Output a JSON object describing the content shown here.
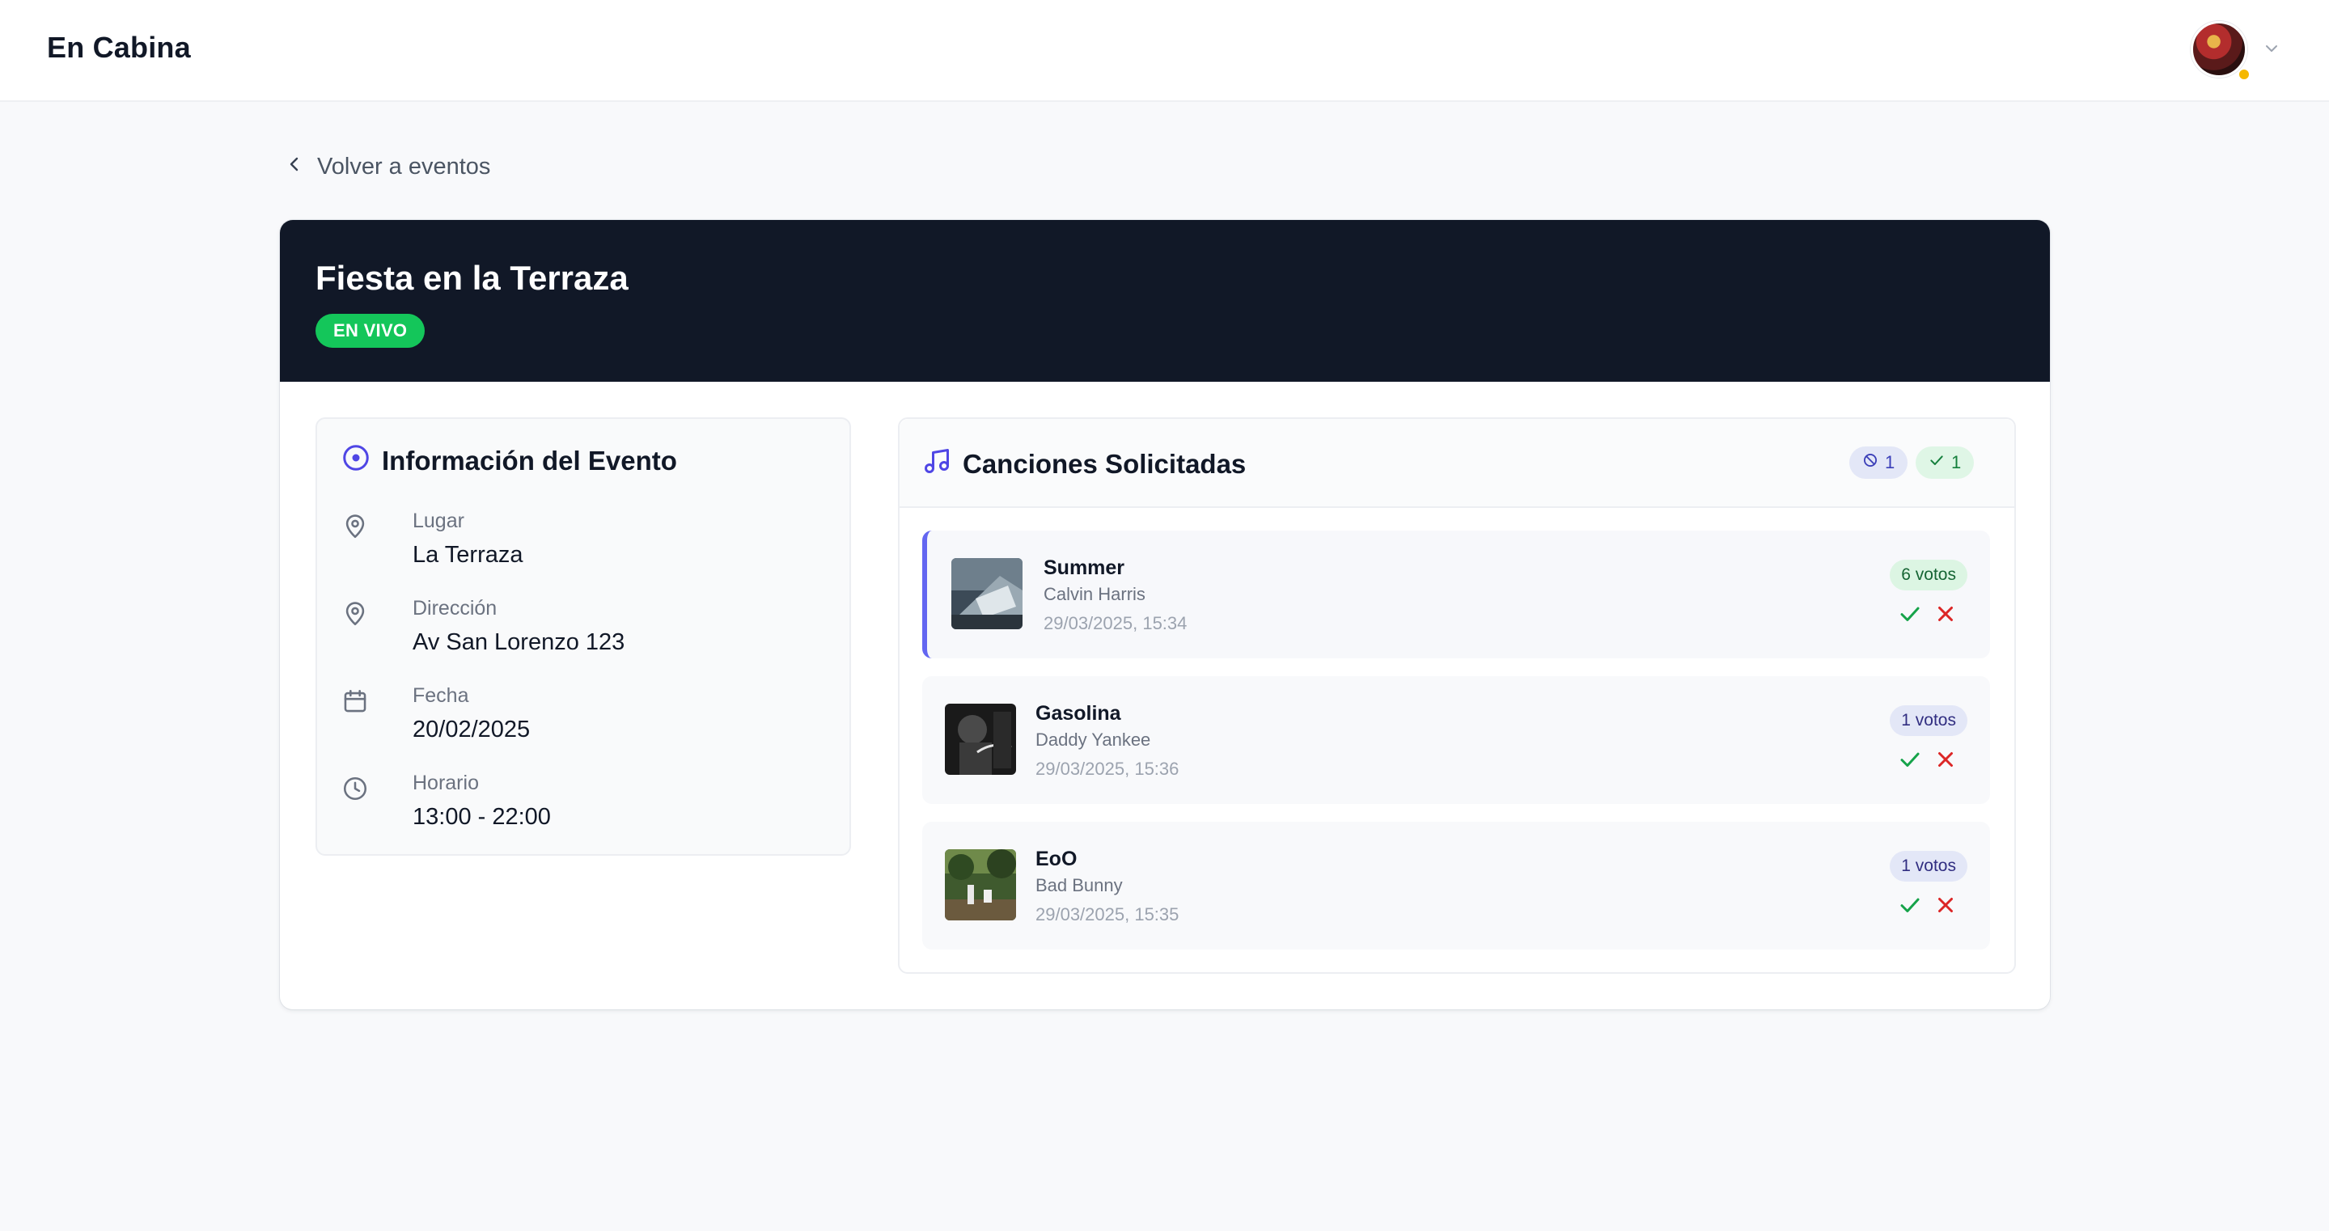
{
  "app": {
    "brand": "En Cabina"
  },
  "nav": {
    "back_label": "Volver a eventos"
  },
  "event": {
    "title": "Fiesta en la Terraza",
    "status": "EN VIVO"
  },
  "info": {
    "heading": "Información del Evento",
    "rows": [
      {
        "label": "Lugar",
        "value": "La Terraza",
        "icon": "map-pin-icon"
      },
      {
        "label": "Dirección",
        "value": "Av San Lorenzo 123",
        "icon": "map-pin-icon"
      },
      {
        "label": "Fecha",
        "value": "20/02/2025",
        "icon": "calendar-icon"
      },
      {
        "label": "Horario",
        "value": "13:00 - 22:00",
        "icon": "clock-icon"
      }
    ]
  },
  "songs": {
    "heading": "Canciones Solicitadas",
    "rejected_count": "1",
    "approved_count": "1",
    "items": [
      {
        "title": "Summer",
        "artist": "Calvin Harris",
        "date": "29/03/2025, 15:34",
        "votes": "6 votos"
      },
      {
        "title": "Gasolina",
        "artist": "Daddy Yankee",
        "date": "29/03/2025, 15:36",
        "votes": "1 votos"
      },
      {
        "title": "EoO",
        "artist": "Bad Bunny",
        "date": "29/03/2025, 15:35",
        "votes": "1 votos"
      }
    ]
  },
  "colors": {
    "accent": "#6366f1",
    "live": "#14c65a",
    "hero": "#111827",
    "approve": "#16a34a",
    "reject": "#dc2626"
  }
}
